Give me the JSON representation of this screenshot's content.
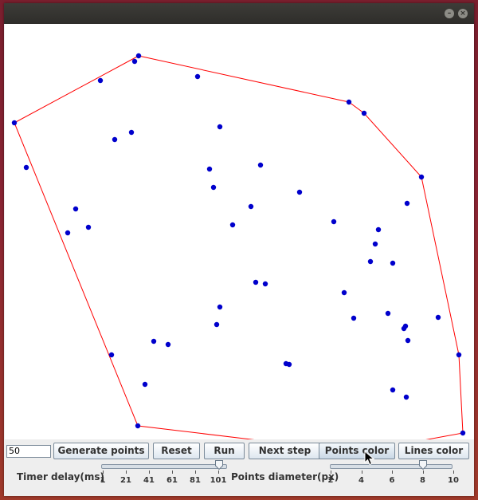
{
  "window": {
    "title": ""
  },
  "colors": {
    "points": "#0000cc",
    "hull": "#ff0000"
  },
  "points": [
    [
      168,
      40
    ],
    [
      163,
      47
    ],
    [
      120,
      71
    ],
    [
      242,
      66
    ],
    [
      12,
      124
    ],
    [
      432,
      98
    ],
    [
      451,
      112
    ],
    [
      270,
      129
    ],
    [
      159,
      136
    ],
    [
      138,
      145
    ],
    [
      27,
      180
    ],
    [
      257,
      182
    ],
    [
      321,
      177
    ],
    [
      262,
      205
    ],
    [
      370,
      211
    ],
    [
      523,
      192
    ],
    [
      505,
      225
    ],
    [
      89,
      232
    ],
    [
      309,
      229
    ],
    [
      79,
      262
    ],
    [
      105,
      255
    ],
    [
      286,
      252
    ],
    [
      413,
      248
    ],
    [
      469,
      258
    ],
    [
      465,
      276
    ],
    [
      459,
      298
    ],
    [
      487,
      300
    ],
    [
      315,
      324
    ],
    [
      327,
      326
    ],
    [
      426,
      337
    ],
    [
      270,
      355
    ],
    [
      481,
      363
    ],
    [
      438,
      369
    ],
    [
      266,
      377
    ],
    [
      503,
      379
    ],
    [
      501,
      382
    ],
    [
      544,
      368
    ],
    [
      506,
      397
    ],
    [
      187,
      398
    ],
    [
      205,
      402
    ],
    [
      134,
      415
    ],
    [
      353,
      426
    ],
    [
      357,
      427
    ],
    [
      570,
      415
    ],
    [
      176,
      452
    ],
    [
      487,
      459
    ],
    [
      504,
      468
    ],
    [
      167,
      504
    ],
    [
      443,
      537
    ],
    [
      575,
      513
    ]
  ],
  "hull": [
    [
      168,
      40
    ],
    [
      432,
      98
    ],
    [
      451,
      112
    ],
    [
      523,
      192
    ],
    [
      570,
      415
    ],
    [
      575,
      513
    ],
    [
      443,
      537
    ],
    [
      167,
      504
    ],
    [
      12,
      124
    ],
    [
      168,
      40
    ]
  ],
  "controls": {
    "count_value": "50",
    "buttons": {
      "generate": "Generate points",
      "reset": "Reset",
      "run": "Run",
      "next": "Next step",
      "points_color": "Points color",
      "lines_color": "Lines color"
    },
    "timer": {
      "label": "Timer delay(ms)",
      "ticks": [
        "1",
        "21",
        "41",
        "61",
        "81",
        "101"
      ],
      "value": 101
    },
    "diameter": {
      "label": "Points diameter(px)",
      "ticks": [
        "2",
        "4",
        "6",
        "8",
        "10"
      ],
      "value": 8
    }
  }
}
